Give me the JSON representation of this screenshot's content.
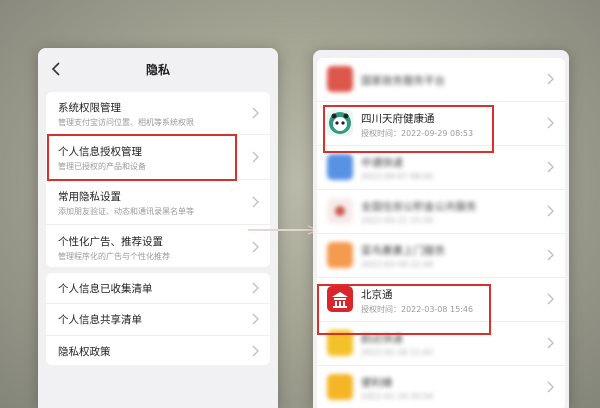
{
  "left_screen": {
    "title": "隐私",
    "group1": [
      {
        "title": "系统权限管理",
        "sub": "管理支付宝访问位置、相机等系统权限"
      },
      {
        "title": "个人信息授权管理",
        "sub": "管理已授权的产品和设备"
      },
      {
        "title": "常用隐私设置",
        "sub": "添加朋友验证、动态和通讯录黑名单等"
      },
      {
        "title": "个性化广告、推荐设置",
        "sub": "管理程序化的广告与个性化推荐"
      }
    ],
    "group2": [
      {
        "title": "个人信息已收集清单"
      },
      {
        "title": "个人信息共享清单"
      },
      {
        "title": "隐私权政策"
      }
    ]
  },
  "right_screen": {
    "items": [
      {
        "title": "国家政务服务平台",
        "sub": "",
        "icon": "gov-service-icon",
        "color": "#d83a2e",
        "blurred": true
      },
      {
        "title": "四川天府健康通",
        "sub": "授权时间：2022-09-29 08:53",
        "icon": "tianfu-health-icon",
        "color": "#2f9a7f",
        "blurred": false
      },
      {
        "title": "中通快递",
        "sub": "2022-09-07 09:05",
        "icon": "zto-icon",
        "color": "#3b7fdf",
        "blurred": true
      },
      {
        "title": "全国住房公积金公共服务",
        "sub": "2022-05-11 15:30",
        "icon": "housing-fund-icon",
        "color": "#c0392b",
        "blurred": true
      },
      {
        "title": "菜鸟裹裹上门服务",
        "sub": "2022-03-18 22:44",
        "icon": "cainiao-icon",
        "color": "#f28a30",
        "blurred": true
      },
      {
        "title": "北京通",
        "sub": "授权时间：2022-03-08 15:46",
        "icon": "beijing-tong-icon",
        "color": "#d8262c",
        "blurred": false
      },
      {
        "title": "韵达快递",
        "sub": "2022-02-18 11:02",
        "icon": "yunda-icon",
        "color": "#f2b705",
        "blurred": true
      },
      {
        "title": "便利蜂",
        "sub": "2022-01-19 20:54",
        "icon": "bianlifeng-icon",
        "color": "#f2a900",
        "blurred": true
      }
    ]
  },
  "colors": {
    "highlight": "#d9302b",
    "background": "#a4a593"
  }
}
